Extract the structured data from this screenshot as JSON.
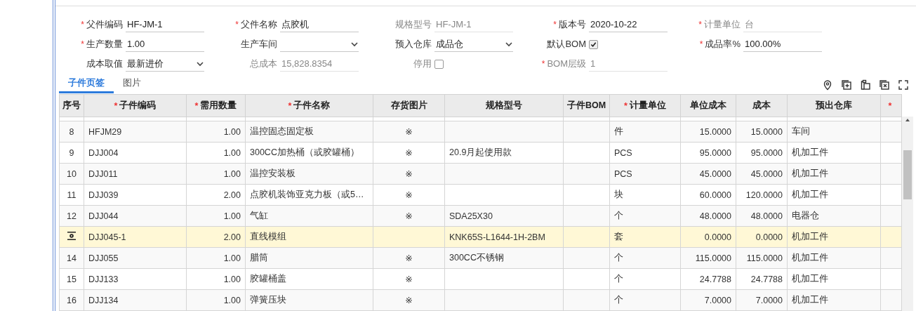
{
  "form": {
    "rows": [
      [
        {
          "label": "父件编码",
          "required": "*",
          "kind": "text",
          "value": "HF-JM-1",
          "disabled": false
        },
        {
          "label": "父件名称",
          "required": "*",
          "kind": "text",
          "value": "点胶机",
          "disabled": false
        },
        {
          "label": "规格型号",
          "kind": "text",
          "value": "HF-JM-1",
          "disabled": true
        },
        {
          "label": "版本号",
          "required": "*",
          "kind": "text",
          "value": "2020-10-22",
          "disabled": false
        },
        {
          "label": "计量单位",
          "required": "*",
          "kind": "text",
          "value": "台",
          "disabled": true
        }
      ],
      [
        {
          "label": "生产数量",
          "required": "*",
          "kind": "text",
          "value": "1.00",
          "disabled": false
        },
        {
          "label": "生产车间",
          "kind": "select",
          "disabled": false
        },
        {
          "label": "预入仓库",
          "kind": "select",
          "value": "成品仓",
          "disabled": false
        },
        {
          "label": "默认BOM",
          "kind": "checkbox",
          "checked": true,
          "disabled": false
        },
        {
          "label": "成品率%",
          "required": "*",
          "kind": "text",
          "value": "100.00%",
          "disabled": false
        }
      ],
      [
        {
          "label": "成本取值",
          "kind": "select",
          "value": "最新进价",
          "disabled": false
        },
        {
          "label": "总成本",
          "kind": "text",
          "value": "15,828.8354",
          "disabled": true
        },
        {
          "label": "停用",
          "kind": "checkbox",
          "checked": false,
          "disabled": true
        },
        {
          "label": "BOM层级",
          "required": "*",
          "kind": "text",
          "value": "1",
          "disabled": true
        }
      ]
    ]
  },
  "tabs": [
    {
      "label": "子件页签",
      "selected": true
    },
    {
      "label": "图片",
      "selected": false
    }
  ],
  "table": {
    "columns": [
      {
        "label": "序号"
      },
      {
        "label": "子件编码",
        "required": "*"
      },
      {
        "label": "需用数量",
        "required": "*"
      },
      {
        "label": "子件名称",
        "required": "*"
      },
      {
        "label": "存货图片"
      },
      {
        "label": "规格型号"
      },
      {
        "label": "子件BOM"
      },
      {
        "label": "计量单位",
        "required": "*"
      },
      {
        "label": "单位成本"
      },
      {
        "label": "成本"
      },
      {
        "label": "预出仓库"
      },
      {
        "required": "*"
      }
    ],
    "rows": [
      {
        "no": "8",
        "code": "HFJM29",
        "qty": "1.00",
        "name": "温控固态固定板",
        "image": "※",
        "spec": "",
        "unit": "件",
        "unit_cost": "15.0000",
        "cost": "15.0000",
        "warehouse": "车间",
        "selected": false
      },
      {
        "no": "9",
        "code": "DJJ004",
        "qty": "1.00",
        "name": "300CC加热桶（或胶罐桶）",
        "image": "※",
        "spec": "20.9月起使用款",
        "unit": "PCS",
        "unit_cost": "95.0000",
        "cost": "95.0000",
        "warehouse": "机加工件",
        "selected": false
      },
      {
        "no": "10",
        "code": "DJJ011",
        "qty": "1.00",
        "name": "温控安装板",
        "image": "※",
        "spec": "",
        "unit": "PCS",
        "unit_cost": "45.0000",
        "cost": "45.0000",
        "warehouse": "机加工件",
        "selected": false
      },
      {
        "no": "11",
        "code": "DJJ039",
        "qty": "2.00",
        "name": "点胶机装饰亚克力板（或5…",
        "image": "※",
        "spec": "",
        "unit": "块",
        "unit_cost": "60.0000",
        "cost": "120.0000",
        "warehouse": "机加工件",
        "selected": false
      },
      {
        "no": "12",
        "code": "DJJ044",
        "qty": "1.00",
        "name": "气缸",
        "image": "※",
        "spec": "SDA25X30",
        "unit": "个",
        "unit_cost": "48.0000",
        "cost": "48.0000",
        "warehouse": "电器仓",
        "selected": false
      },
      {
        "code": "DJJ045-1",
        "qty": "2.00",
        "name": "直线模组",
        "image": "",
        "spec": "KNK65S-L1644-1H-2BM",
        "unit": "套",
        "unit_cost": "0.0000",
        "cost": "0.0000",
        "warehouse": "机加工件",
        "selected": true
      },
      {
        "no": "14",
        "code": "DJJ055",
        "qty": "1.00",
        "name": "腊筒",
        "image": "※",
        "spec": "300CC不锈钢",
        "unit": "个",
        "unit_cost": "115.0000",
        "cost": "115.0000",
        "warehouse": "机加工件",
        "selected": false
      },
      {
        "no": "15",
        "code": "DJJ133",
        "qty": "1.00",
        "name": "胶罐桶盖",
        "image": "※",
        "spec": "",
        "unit": "个",
        "unit_cost": "24.7788",
        "cost": "24.7788",
        "warehouse": "机加工件",
        "selected": false
      },
      {
        "no": "16",
        "code": "DJJ134",
        "qty": "1.00",
        "name": "弹簧压块",
        "image": "※",
        "spec": "",
        "unit": "个",
        "unit_cost": "7.0000",
        "cost": "7.0000",
        "warehouse": "机加工件",
        "selected": false
      }
    ]
  }
}
